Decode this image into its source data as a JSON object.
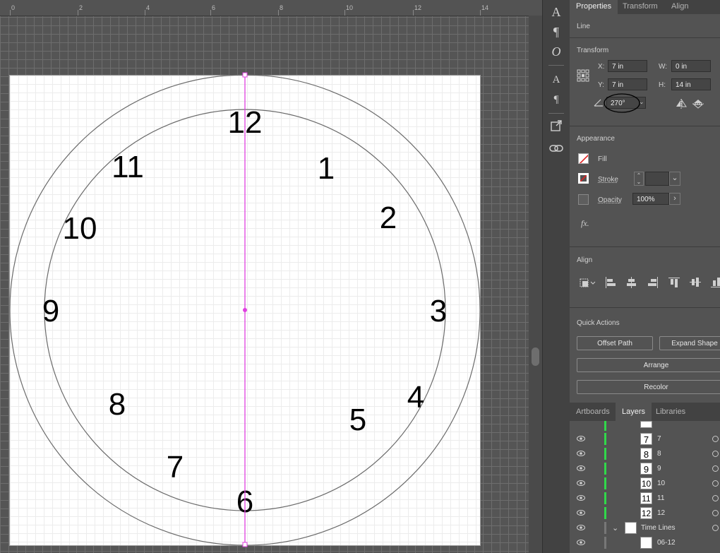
{
  "ruler": {
    "labels": [
      "0",
      "2",
      "4",
      "6",
      "8",
      "10",
      "12",
      "14"
    ]
  },
  "clock": {
    "numerals": [
      "12",
      "1",
      "2",
      "3",
      "4",
      "5",
      "6",
      "7",
      "8",
      "9",
      "10",
      "11"
    ]
  },
  "tools": [
    "character-icon",
    "paragraph-icon",
    "opentype-icon",
    "char-styles-icon",
    "para-styles-icon",
    "export-icon",
    "link-icon"
  ],
  "panel": {
    "tabs": [
      "Properties",
      "Transform",
      "Align"
    ],
    "object_type": "Line",
    "transform": {
      "title": "Transform",
      "x_label": "X:",
      "x_value": "7 in",
      "y_label": "Y:",
      "y_value": "7 in",
      "w_label": "W:",
      "w_value": "0 in",
      "h_label": "H:",
      "h_value": "14 in",
      "angle_value": "270°"
    },
    "appearance": {
      "title": "Appearance",
      "fill_label": "Fill",
      "stroke_label": "Stroke",
      "opacity_label": "Opacity",
      "opacity_value": "100%",
      "fx_label": "fx."
    },
    "align": {
      "title": "Align"
    },
    "quick_actions": {
      "title": "Quick Actions",
      "offset_path": "Offset Path",
      "expand_shape": "Expand Shape",
      "arrange": "Arrange",
      "recolor": "Recolor"
    }
  },
  "layers_panel": {
    "tabs": [
      "Artboards",
      "Layers",
      "Libraries"
    ],
    "rows": [
      {
        "thumb": "7",
        "name": "7"
      },
      {
        "thumb": "8",
        "name": "8"
      },
      {
        "thumb": "9",
        "name": "9"
      },
      {
        "thumb": "10",
        "name": "10"
      },
      {
        "thumb": "11",
        "name": "11"
      },
      {
        "thumb": "12",
        "name": "12"
      },
      {
        "thumb": "",
        "name": "Time Lines"
      },
      {
        "thumb": "",
        "name": "06-12"
      }
    ]
  },
  "colors": {
    "selection": "#e040e0",
    "layer_color": "#31d84a",
    "panel_bg": "#535353"
  }
}
